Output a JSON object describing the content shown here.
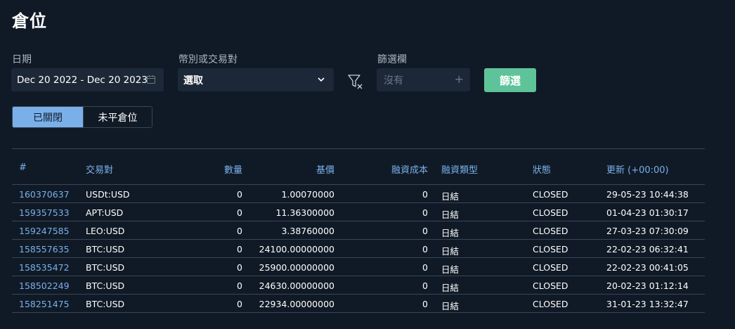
{
  "page": {
    "title": "倉位"
  },
  "filters": {
    "date_label": "日期",
    "date_value": "Dec 20 2022 - Dec 20 2023",
    "pair_label": "幣別或交易對",
    "pair_value": "選取",
    "column_label": "篩選欄",
    "column_placeholder": "沒有",
    "apply_label": "篩選"
  },
  "tabs": {
    "closed": "已關閉",
    "open": "未平倉位",
    "active": "closed"
  },
  "table": {
    "headers": {
      "id": "#",
      "pair": "交易對",
      "amount": "數量",
      "base": "基價",
      "funding_cost": "融資成本",
      "funding_type": "融資類型",
      "status": "狀態",
      "updated": "更新 (+00:00)"
    },
    "rows": [
      {
        "id": "160370637",
        "pair": "USDt:USD",
        "amount": "0",
        "base": "1.00070000",
        "funding_cost": "0",
        "funding_type": "日結",
        "status": "CLOSED",
        "updated": "29-05-23 10:44:38"
      },
      {
        "id": "159357533",
        "pair": "APT:USD",
        "amount": "0",
        "base": "11.36300000",
        "funding_cost": "0",
        "funding_type": "日結",
        "status": "CLOSED",
        "updated": "01-04-23 01:30:17"
      },
      {
        "id": "159247585",
        "pair": "LEO:USD",
        "amount": "0",
        "base": "3.38760000",
        "funding_cost": "0",
        "funding_type": "日結",
        "status": "CLOSED",
        "updated": "27-03-23 07:30:09"
      },
      {
        "id": "158557635",
        "pair": "BTC:USD",
        "amount": "0",
        "base": "24100.00000000",
        "funding_cost": "0",
        "funding_type": "日結",
        "status": "CLOSED",
        "updated": "22-02-23 06:32:41"
      },
      {
        "id": "158535472",
        "pair": "BTC:USD",
        "amount": "0",
        "base": "25900.00000000",
        "funding_cost": "0",
        "funding_type": "日結",
        "status": "CLOSED",
        "updated": "22-02-23 00:41:05"
      },
      {
        "id": "158502249",
        "pair": "BTC:USD",
        "amount": "0",
        "base": "24630.00000000",
        "funding_cost": "0",
        "funding_type": "日結",
        "status": "CLOSED",
        "updated": "20-02-23 01:12:14"
      },
      {
        "id": "158251475",
        "pair": "BTC:USD",
        "amount": "0",
        "base": "22934.00000000",
        "funding_cost": "0",
        "funding_type": "日結",
        "status": "CLOSED",
        "updated": "31-01-23 13:32:47"
      }
    ]
  },
  "colors": {
    "background": "#101a26",
    "input_bg": "#1c2838",
    "accent_blue": "#7ab0ea",
    "accent_green": "#5fc39a",
    "border": "#3a4656"
  },
  "icons": {
    "date": "calendar-icon",
    "select": "chevron-down-icon",
    "clear": "filter-clear-icon",
    "add": "plus-icon"
  }
}
